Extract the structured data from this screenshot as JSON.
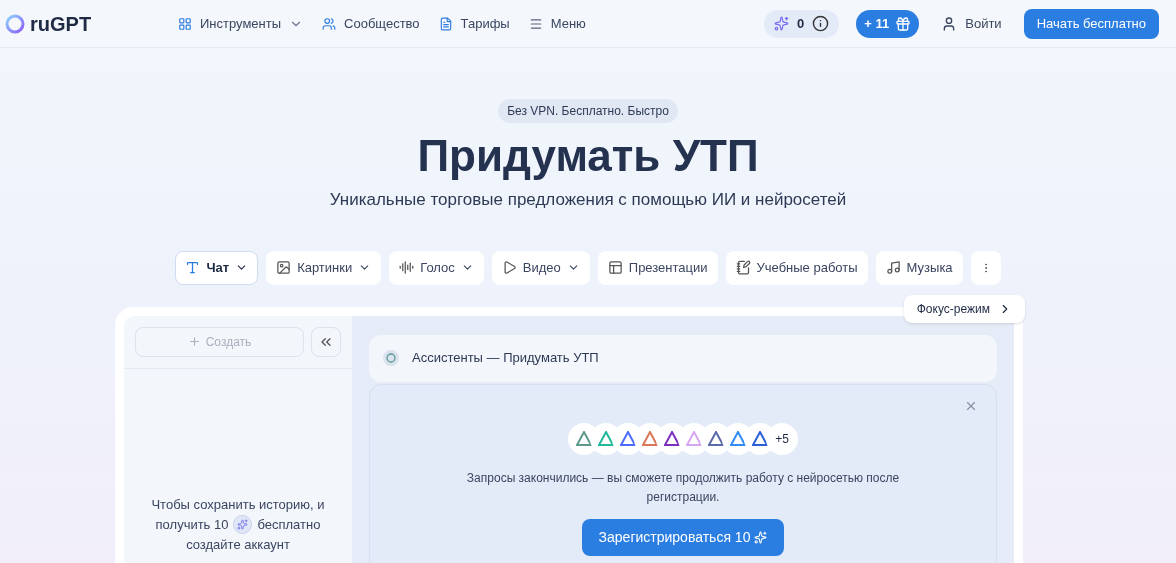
{
  "header": {
    "logo": "ruGPT",
    "nav": [
      {
        "label": "Инструменты",
        "kind": "tools",
        "has_menu": true
      },
      {
        "label": "Сообщество",
        "kind": "community",
        "has_menu": false
      },
      {
        "label": "Тарифы",
        "kind": "pricing",
        "has_menu": false
      },
      {
        "label": "Меню",
        "kind": "menu",
        "has_menu": false
      }
    ],
    "balance": "0",
    "bonus": "+ 11",
    "login": "Войти",
    "cta": "Начать бесплатно"
  },
  "hero": {
    "badge": "Без VPN. Бесплатно. Быстро",
    "title": "Придумать УТП",
    "subtitle": "Уникальные торговые предложения с помощью ИИ и нейросетей"
  },
  "tools": [
    {
      "label": "Чат",
      "kind": "chat",
      "selected": true,
      "has_menu": true
    },
    {
      "label": "Картинки",
      "kind": "images",
      "selected": false,
      "has_menu": true
    },
    {
      "label": "Голос",
      "kind": "voice",
      "selected": false,
      "has_menu": true
    },
    {
      "label": "Видео",
      "kind": "video",
      "selected": false,
      "has_menu": true
    },
    {
      "label": "Презентации",
      "kind": "slides",
      "selected": false,
      "has_menu": false
    },
    {
      "label": "Учебные работы",
      "kind": "study",
      "selected": false,
      "has_menu": false
    },
    {
      "label": "Музыка",
      "kind": "music",
      "selected": false,
      "has_menu": false
    }
  ],
  "focus_mode": "Фокус-режим",
  "sidebar": {
    "create": "Создать",
    "note_line1": "Чтобы сохранить историю, и",
    "note_before_icon": "получить 10",
    "note_after_icon": "бесплатно",
    "note_line3": "создайте аккаунт"
  },
  "chat": {
    "title": "Ассистенты — Придумать УТП",
    "models": [
      {
        "color": "#5b9a8b"
      },
      {
        "color": "#1fb89a"
      },
      {
        "color": "#4d6bfe"
      },
      {
        "color": "#d97757"
      },
      {
        "color": "#7b2fbe"
      },
      {
        "color": "#d8a6f0"
      },
      {
        "color": "#5a6aa8"
      },
      {
        "color": "#2f8cf5"
      },
      {
        "color": "#2b5fd9"
      }
    ],
    "more_models": "+5",
    "message": "Запросы закончились — вы сможете продолжить работу с нейросетью после регистрации.",
    "register": "Зарегистрироваться 10"
  }
}
